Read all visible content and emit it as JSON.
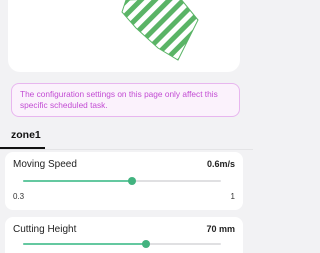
{
  "map": {
    "stripe_colors": [
      "#5ab466",
      "#ffffff"
    ]
  },
  "notice": {
    "text": "The configuration settings on this page only affect this specific scheduled task."
  },
  "tabs": [
    {
      "label": "zone1",
      "active": true
    }
  ],
  "settings": {
    "moving_speed": {
      "label": "Moving Speed",
      "value": "0.6m/s",
      "min_label": "0.3",
      "max_label": "1",
      "level": 0.55
    },
    "cutting_height": {
      "label": "Cutting Height",
      "value": "70 mm",
      "level": 0.62
    }
  },
  "colors": {
    "accent": "#42b37f",
    "track_fill": "#64c8a0",
    "notice_text": "#c24bd3",
    "notice_border": "#e8b6ef"
  }
}
